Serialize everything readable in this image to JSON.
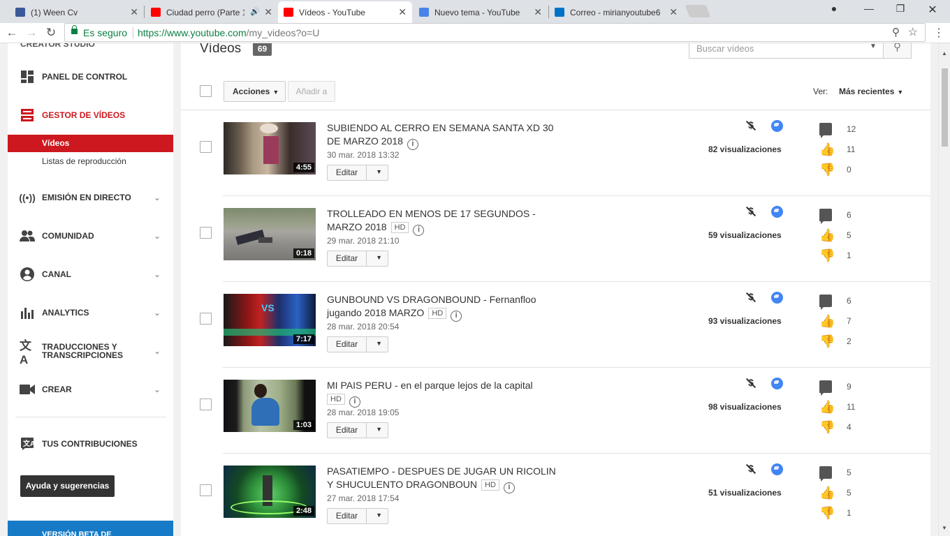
{
  "browser": {
    "tabs": [
      {
        "title": "(1) Ween Cv",
        "favicon_color": "#3b5998"
      },
      {
        "title": "Ciudad perro (Parte 1",
        "favicon_color": "#ff0000",
        "audio": "🔊"
      },
      {
        "title": "Vídeos - YouTube",
        "favicon_color": "#ff0000"
      },
      {
        "title": "Nuevo tema - YouTube",
        "favicon_color": "#4a84e8"
      },
      {
        "title": "Correo - mirianyoutube6",
        "favicon_color": "#0072c6"
      }
    ],
    "close_glyph": "✕",
    "secure_label": "Es seguro",
    "url_host": "https://www.youtube.com",
    "url_path": "/my_videos?o=U"
  },
  "sidebar": {
    "studio_title": "CREATOR STUDIO",
    "items": [
      {
        "label": "PANEL DE CONTROL",
        "icon": "dashboard-icon"
      },
      {
        "label": "GESTOR DE VÍDEOS",
        "icon": "video-manager-icon"
      },
      {
        "label": "EMISIÓN EN DIRECTO",
        "icon": "live-icon"
      },
      {
        "label": "COMUNIDAD",
        "icon": "community-icon"
      },
      {
        "label": "CANAL",
        "icon": "channel-icon"
      },
      {
        "label": "ANALYTICS",
        "icon": "analytics-icon"
      },
      {
        "label": "TRADUCCIONES Y TRANSCRIPCIONES",
        "icon": "translate-icon"
      },
      {
        "label": "CREAR",
        "icon": "camera-icon"
      },
      {
        "label": "TUS CONTRIBUCIONES",
        "icon": "contributions-icon"
      }
    ],
    "sub_items": [
      "Vídeos",
      "Listas de reproducción"
    ],
    "help_button": "Ayuda y sugerencias",
    "beta_banner": "VERSIÓN BETA DE",
    "accent_color": "#cc181e"
  },
  "main": {
    "title": "Vídeos",
    "count": "69",
    "search_placeholder": "Buscar vídeos",
    "actions_label": "Acciones",
    "add_to_label": "Añadir a",
    "view_label": "Ver:",
    "sort_label": "Más recientes",
    "edit_label": "Editar",
    "hd_badge": "HD",
    "videos": [
      {
        "title": "SUBIENDO AL CERRO EN SEMANA SANTA XD 30 DE MARZO 2018",
        "hd": false,
        "date": "30 mar. 2018 13:32",
        "duration": "4:55",
        "views": "82 visualizaciones",
        "comments": "12",
        "likes": "11",
        "dislikes": "0"
      },
      {
        "title": "TROLLEADO EN MENOS DE 17 SEGUNDOS - MARZO 2018",
        "hd": true,
        "date": "29 mar. 2018 21:10",
        "duration": "0:18",
        "views": "59 visualizaciones",
        "comments": "6",
        "likes": "5",
        "dislikes": "1"
      },
      {
        "title": "GUNBOUND VS DRAGONBOUND - Fernanfloo jugando 2018 MARZO",
        "hd": true,
        "date": "28 mar. 2018 20:54",
        "duration": "7:17",
        "views": "93 visualizaciones",
        "comments": "6",
        "likes": "7",
        "dislikes": "2"
      },
      {
        "title": "MI PAIS PERU - en el parque lejos de la capital",
        "hd": true,
        "date": "28 mar. 2018 19:05",
        "duration": "1:03",
        "views": "98 visualizaciones",
        "comments": "9",
        "likes": "11",
        "dislikes": "4"
      },
      {
        "title": "PASATIEMPO - DESPUES DE JUGAR UN RICOLIN Y SHUCULENTO DRAGONBOUN",
        "hd": true,
        "date": "27 mar. 2018 17:54",
        "duration": "2:48",
        "views": "51 visualizaciones",
        "comments": "5",
        "likes": "5",
        "dislikes": "1"
      }
    ]
  }
}
